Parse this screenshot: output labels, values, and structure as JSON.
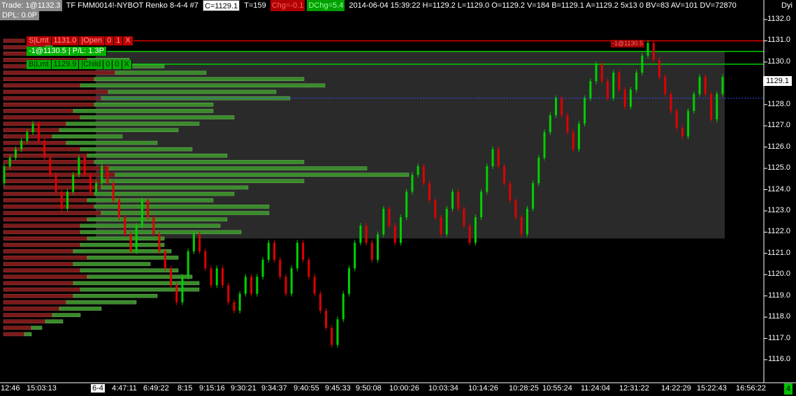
{
  "header": {
    "trade": "Trade: 1@1132.3",
    "symbol": "TF  FMM0014!-NYBOT  Renko 8-4-4  #7",
    "close": "C=1129.1",
    "ticks": "T=159",
    "chg": "Chg=-0.1",
    "dchg": "DChg=5.4",
    "stats": "2014-06-04 15:39:22 H=1129.2 L=1129.0 O=1129.2 V=184 B=1129.1 A=1129.2 5x13 0 BV=83 AV=101 DV=72870",
    "dyn": "Dyi",
    "dpl": "DPL: 0.0P"
  },
  "orders": {
    "sell": [
      "S|Lmt",
      "1131.0",
      "|Open",
      "0",
      "1",
      "X"
    ],
    "position": "-1@1130.5 | P/L: 1.3P",
    "buy": [
      "B|Lmt",
      "1129.9",
      "|Child",
      "0",
      "0",
      "X"
    ],
    "fill_tag": "-1@1130.5"
  },
  "price_axis": {
    "labels": [
      "1132.0",
      "1131.0",
      "1130.0",
      "1129.0",
      "1128.0",
      "1127.0",
      "1126.0",
      "1125.0",
      "1124.0",
      "1123.0",
      "1122.0",
      "1121.0",
      "1120.0",
      "1119.0",
      "1118.0",
      "1117.0",
      "1116.0"
    ],
    "current_price": "1129.1"
  },
  "time_axis": {
    "labels": [
      "12:46",
      "15:03:13",
      "6-4",
      "4:47:11",
      "6:49:22",
      "8:15",
      "9:15:16",
      "9:30:21",
      "9:34:37",
      "9:40:55",
      "9:45:33",
      "9:50:08",
      "10:00:26",
      "10:03:34",
      "10:14:26",
      "10:28:25",
      "10:55:24",
      "11:24:04",
      "12:31:22",
      "14:22:29",
      "15:22:43",
      "16:56:22"
    ],
    "corner": "4"
  },
  "colors": {
    "up": "#00d000",
    "down": "#e00000",
    "sell_line": "#e00000",
    "buy_line": "#00d000",
    "vp_down": "#7a1a1a",
    "vp_up": "#3a8a2a"
  },
  "chart_data": {
    "type": "renko",
    "ylim": [
      1115.5,
      1132.5
    ],
    "brick_size": 0.4,
    "bricks": [
      [
        1124.3,
        1125.1
      ],
      [
        1125.1,
        1125.5
      ],
      [
        1125.5,
        1125.9
      ],
      [
        1125.9,
        1126.3
      ],
      [
        1126.3,
        1126.7
      ],
      [
        1126.7,
        1127.1
      ],
      [
        1127.1,
        1126.3
      ],
      [
        1126.3,
        1125.5
      ],
      [
        1125.5,
        1124.7
      ],
      [
        1124.7,
        1123.9
      ],
      [
        1123.9,
        1123.1
      ],
      [
        1123.1,
        1123.9
      ],
      [
        1123.9,
        1124.7
      ],
      [
        1124.7,
        1125.5
      ],
      [
        1125.5,
        1124.7
      ],
      [
        1124.7,
        1123.9
      ],
      [
        1123.9,
        1124.3
      ],
      [
        1124.3,
        1125.1
      ],
      [
        1125.1,
        1124.3
      ],
      [
        1124.3,
        1123.5
      ],
      [
        1123.5,
        1122.7
      ],
      [
        1122.7,
        1121.9
      ],
      [
        1121.9,
        1121.1
      ],
      [
        1121.1,
        1122.3
      ],
      [
        1122.3,
        1123.5
      ],
      [
        1123.5,
        1122.7
      ],
      [
        1122.7,
        1121.9
      ],
      [
        1121.9,
        1121.1
      ],
      [
        1121.1,
        1120.3
      ],
      [
        1120.3,
        1119.5
      ],
      [
        1119.5,
        1118.7
      ],
      [
        1118.7,
        1119.9
      ],
      [
        1119.9,
        1121.1
      ],
      [
        1121.1,
        1121.9
      ],
      [
        1121.9,
        1121.1
      ],
      [
        1121.1,
        1120.3
      ],
      [
        1120.3,
        1119.5
      ],
      [
        1119.5,
        1120.3
      ],
      [
        1120.3,
        1119.5
      ],
      [
        1119.5,
        1118.7
      ],
      [
        1118.7,
        1118.3
      ],
      [
        1118.3,
        1119.1
      ],
      [
        1119.1,
        1119.9
      ],
      [
        1119.9,
        1119.1
      ],
      [
        1119.1,
        1119.9
      ],
      [
        1119.9,
        1120.7
      ],
      [
        1120.7,
        1121.5
      ],
      [
        1121.5,
        1120.7
      ],
      [
        1120.7,
        1119.9
      ],
      [
        1119.9,
        1119.1
      ],
      [
        1119.1,
        1120.3
      ],
      [
        1120.3,
        1121.5
      ],
      [
        1121.5,
        1120.7
      ],
      [
        1120.7,
        1119.9
      ],
      [
        1119.9,
        1119.1
      ],
      [
        1119.1,
        1118.3
      ],
      [
        1118.3,
        1117.5
      ],
      [
        1117.5,
        1116.7
      ],
      [
        1116.7,
        1117.9
      ],
      [
        1117.9,
        1119.1
      ],
      [
        1119.1,
        1120.3
      ],
      [
        1120.3,
        1121.5
      ],
      [
        1121.5,
        1122.3
      ],
      [
        1122.3,
        1121.5
      ],
      [
        1121.5,
        1120.7
      ],
      [
        1120.7,
        1121.9
      ],
      [
        1121.9,
        1123.1
      ],
      [
        1123.1,
        1122.3
      ],
      [
        1122.3,
        1121.5
      ],
      [
        1121.5,
        1122.7
      ],
      [
        1122.7,
        1123.9
      ],
      [
        1123.9,
        1124.7
      ],
      [
        1124.7,
        1125.1
      ],
      [
        1125.1,
        1124.3
      ],
      [
        1124.3,
        1123.5
      ],
      [
        1123.5,
        1122.7
      ],
      [
        1122.7,
        1121.9
      ],
      [
        1121.9,
        1123.1
      ],
      [
        1123.1,
        1123.9
      ],
      [
        1123.9,
        1123.1
      ],
      [
        1123.1,
        1122.3
      ],
      [
        1122.3,
        1121.5
      ],
      [
        1121.5,
        1122.7
      ],
      [
        1122.7,
        1123.9
      ],
      [
        1123.9,
        1125.1
      ],
      [
        1125.1,
        1125.9
      ],
      [
        1125.9,
        1125.1
      ],
      [
        1125.1,
        1124.3
      ],
      [
        1124.3,
        1123.5
      ],
      [
        1123.5,
        1122.7
      ],
      [
        1122.7,
        1121.9
      ],
      [
        1121.9,
        1123.1
      ],
      [
        1123.1,
        1124.3
      ],
      [
        1124.3,
        1125.5
      ],
      [
        1125.5,
        1126.7
      ],
      [
        1126.7,
        1127.5
      ],
      [
        1127.5,
        1128.3
      ],
      [
        1128.3,
        1127.5
      ],
      [
        1127.5,
        1126.7
      ],
      [
        1126.7,
        1125.9
      ],
      [
        1125.9,
        1127.1
      ],
      [
        1127.1,
        1128.3
      ],
      [
        1128.3,
        1129.1
      ],
      [
        1129.1,
        1129.9
      ],
      [
        1129.9,
        1129.1
      ],
      [
        1129.1,
        1128.3
      ],
      [
        1128.3,
        1129.5
      ],
      [
        1129.5,
        1128.7
      ],
      [
        1128.7,
        1127.9
      ],
      [
        1127.9,
        1128.7
      ],
      [
        1128.7,
        1129.5
      ],
      [
        1129.5,
        1130.3
      ],
      [
        1130.3,
        1130.9
      ],
      [
        1130.9,
        1130.1
      ],
      [
        1130.1,
        1129.3
      ],
      [
        1129.3,
        1128.5
      ],
      [
        1128.5,
        1127.7
      ],
      [
        1127.7,
        1126.9
      ],
      [
        1126.9,
        1126.5
      ],
      [
        1126.5,
        1127.7
      ],
      [
        1127.7,
        1128.5
      ],
      [
        1128.5,
        1129.3
      ],
      [
        1129.3,
        1128.5
      ],
      [
        1128.5,
        1127.3
      ],
      [
        1127.3,
        1128.5
      ],
      [
        1128.5,
        1129.3
      ]
    ],
    "volume_profile": [
      [
        1131.0,
        30,
        0
      ],
      [
        1130.7,
        60,
        10
      ],
      [
        1130.4,
        90,
        30
      ],
      [
        1130.1,
        120,
        60
      ],
      [
        1129.8,
        140,
        90
      ],
      [
        1129.5,
        160,
        130
      ],
      [
        1129.2,
        130,
        300
      ],
      [
        1128.9,
        110,
        350
      ],
      [
        1128.6,
        150,
        240
      ],
      [
        1128.3,
        140,
        270
      ],
      [
        1128.0,
        130,
        170
      ],
      [
        1127.7,
        100,
        200
      ],
      [
        1127.4,
        110,
        220
      ],
      [
        1127.1,
        90,
        190
      ],
      [
        1126.8,
        80,
        170
      ],
      [
        1126.5,
        70,
        100
      ],
      [
        1126.2,
        90,
        130
      ],
      [
        1125.9,
        110,
        160
      ],
      [
        1125.6,
        120,
        200
      ],
      [
        1125.3,
        130,
        300
      ],
      [
        1125.0,
        150,
        370
      ],
      [
        1124.7,
        160,
        420
      ],
      [
        1124.4,
        140,
        290
      ],
      [
        1124.1,
        140,
        210
      ],
      [
        1123.8,
        130,
        200
      ],
      [
        1123.5,
        120,
        180
      ],
      [
        1123.2,
        130,
        250
      ],
      [
        1122.9,
        140,
        240
      ],
      [
        1122.6,
        120,
        200
      ],
      [
        1122.3,
        110,
        200
      ],
      [
        1122.0,
        110,
        230
      ],
      [
        1121.7,
        120,
        110
      ],
      [
        1121.4,
        110,
        120
      ],
      [
        1121.1,
        100,
        140
      ],
      [
        1120.8,
        120,
        130
      ],
      [
        1120.5,
        100,
        110
      ],
      [
        1120.2,
        110,
        140
      ],
      [
        1119.9,
        120,
        150
      ],
      [
        1119.6,
        100,
        180
      ],
      [
        1119.3,
        110,
        170
      ],
      [
        1119.0,
        100,
        120
      ],
      [
        1118.7,
        90,
        100
      ],
      [
        1118.4,
        80,
        60
      ],
      [
        1118.1,
        70,
        40
      ],
      [
        1117.8,
        60,
        25
      ],
      [
        1117.5,
        40,
        15
      ],
      [
        1117.2,
        30,
        10
      ]
    ]
  }
}
